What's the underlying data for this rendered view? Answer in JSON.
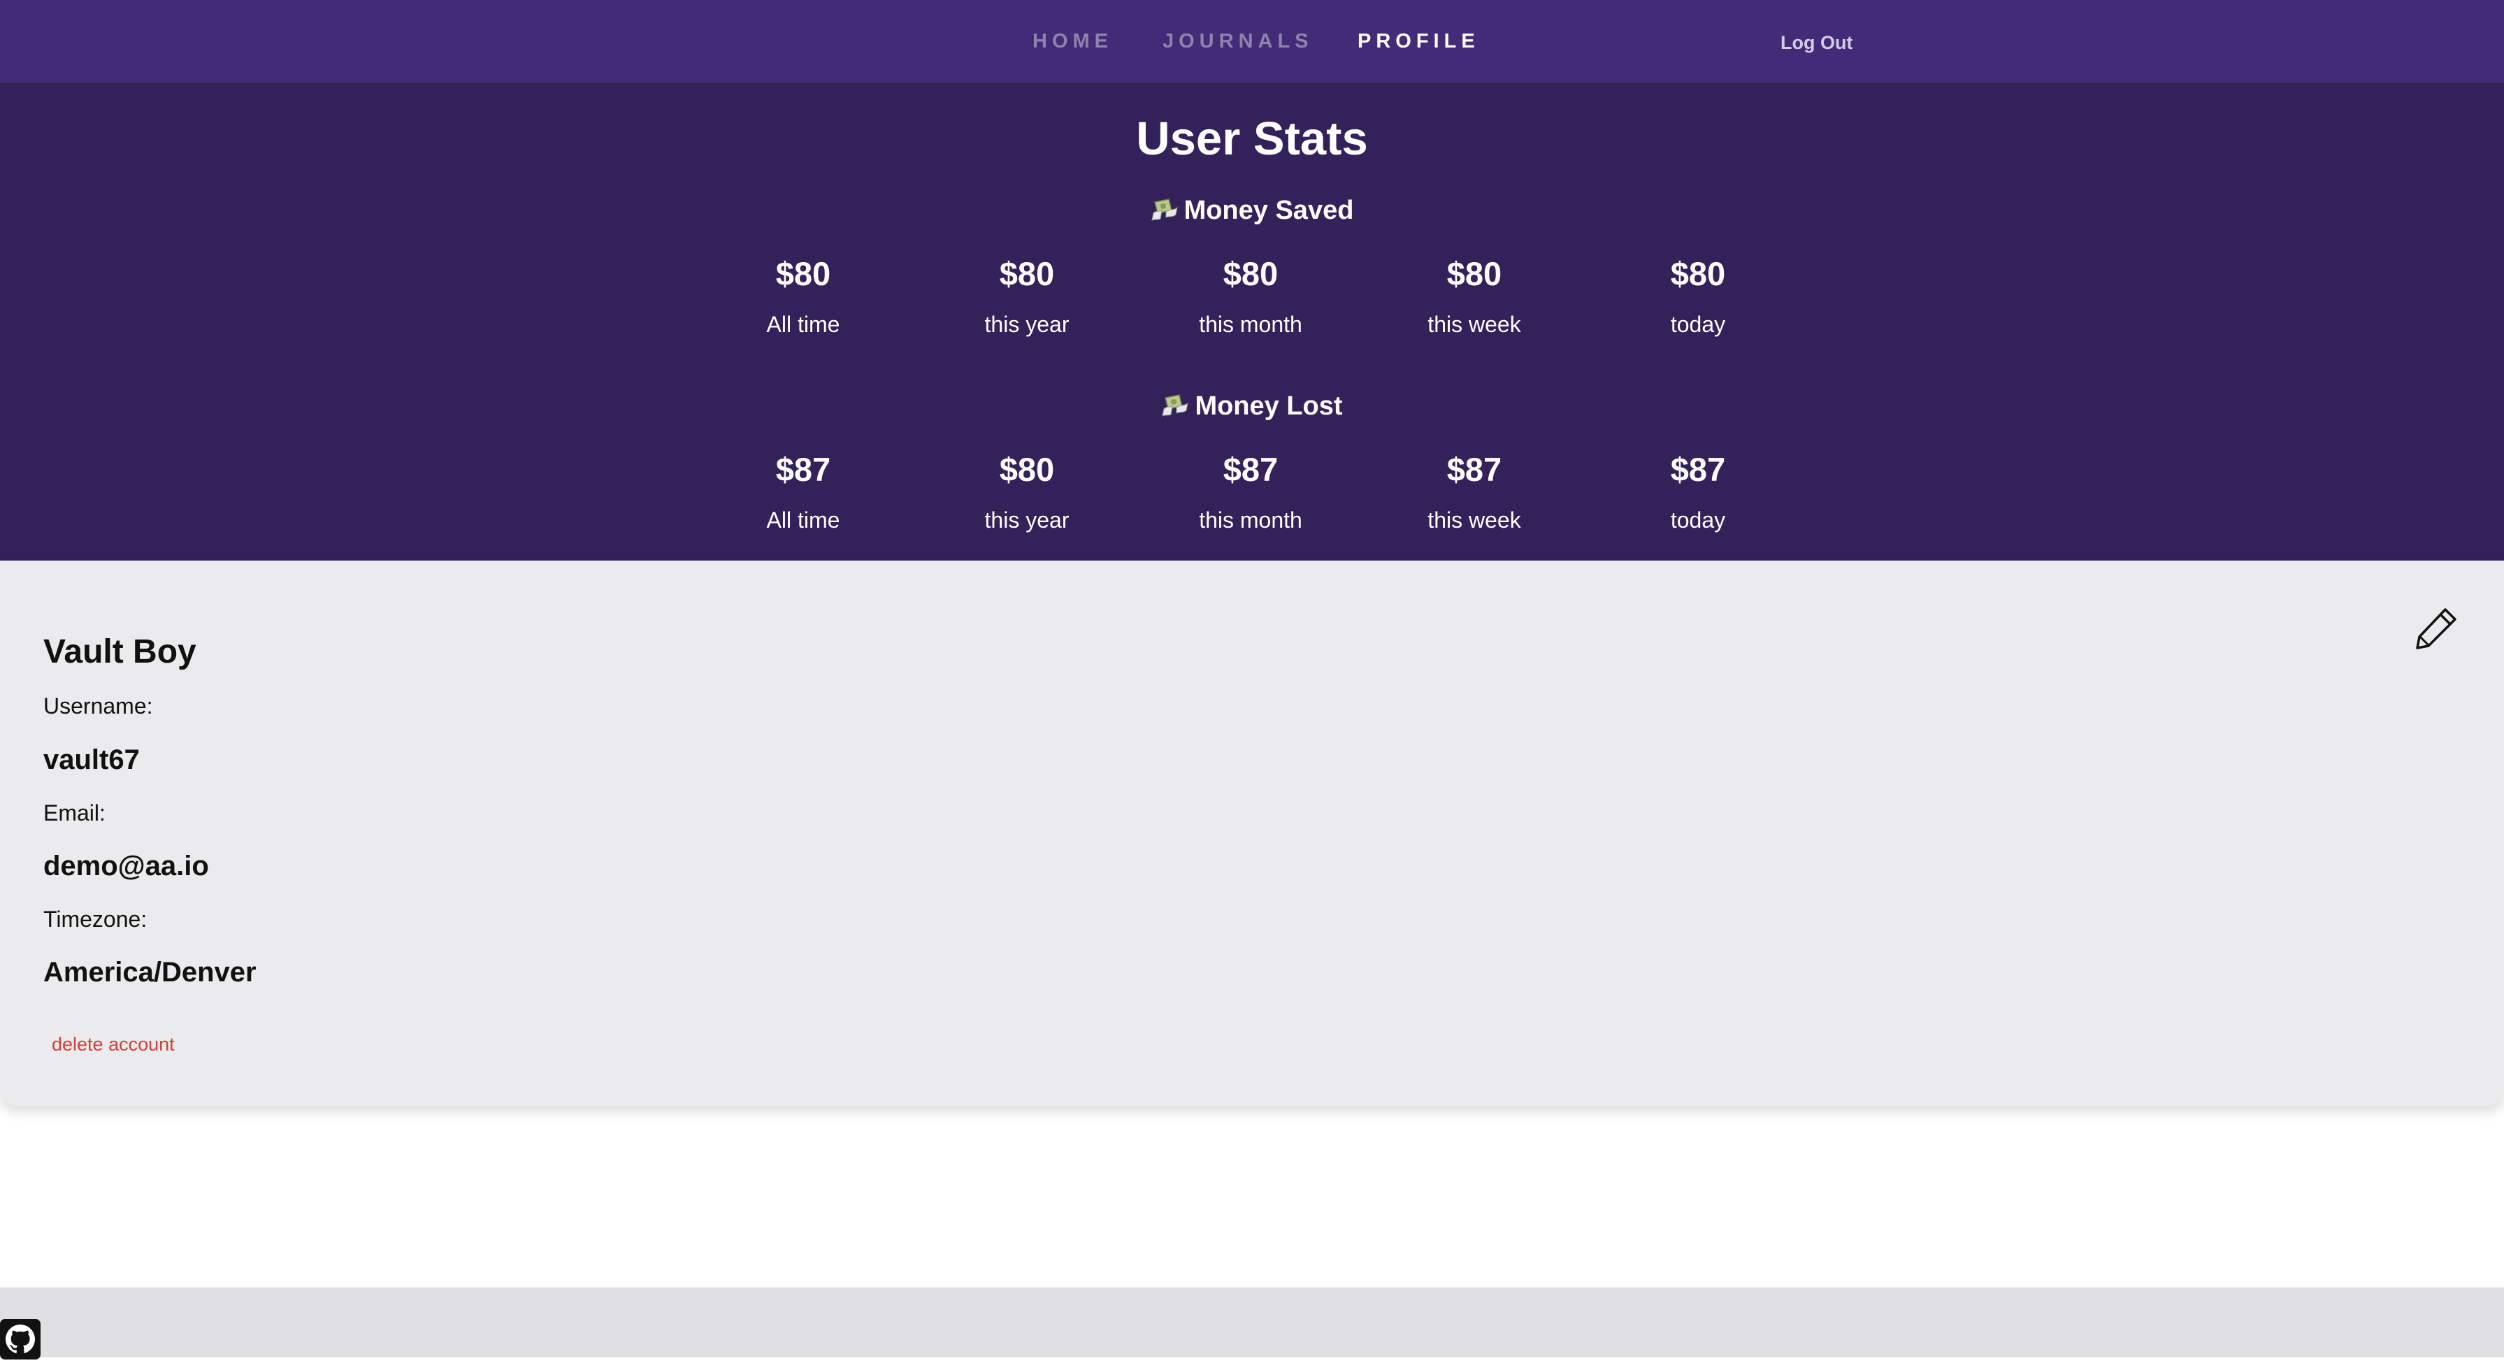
{
  "nav": {
    "links": [
      "HOME",
      "JOURNALS",
      "PROFILE"
    ],
    "active": "PROFILE",
    "logout_label": "Log Out"
  },
  "stats": {
    "title": "User Stats",
    "saved": {
      "heading": "Money Saved",
      "icon": "money-with-wings-icon",
      "items": [
        {
          "value": "$80",
          "label": "All time"
        },
        {
          "value": "$80",
          "label": "this year"
        },
        {
          "value": "$80",
          "label": "this month"
        },
        {
          "value": "$80",
          "label": "this week"
        },
        {
          "value": "$80",
          "label": "today"
        }
      ]
    },
    "lost": {
      "heading": "Money Lost",
      "icon": "money-with-wings-icon",
      "items": [
        {
          "value": "$87",
          "label": "All time"
        },
        {
          "value": "$80",
          "label": "this year"
        },
        {
          "value": "$87",
          "label": "this month"
        },
        {
          "value": "$87",
          "label": "this week"
        },
        {
          "value": "$87",
          "label": "today"
        }
      ]
    }
  },
  "profile": {
    "name": "Vault Boy",
    "username_label": "Username:",
    "username": "vault67",
    "email_label": "Email:",
    "email": "demo@aa.io",
    "timezone_label": "Timezone:",
    "timezone": "America/Denver",
    "delete_label": "delete account",
    "edit_icon": "pencil-icon"
  },
  "footer": {
    "icon": "github-icon"
  },
  "colors": {
    "nav_bg": "#432b78",
    "stats_bg": "#33215a",
    "card_bg": "#ebebed",
    "footer_bg": "#e0e0e2",
    "danger": "#c9433d"
  }
}
